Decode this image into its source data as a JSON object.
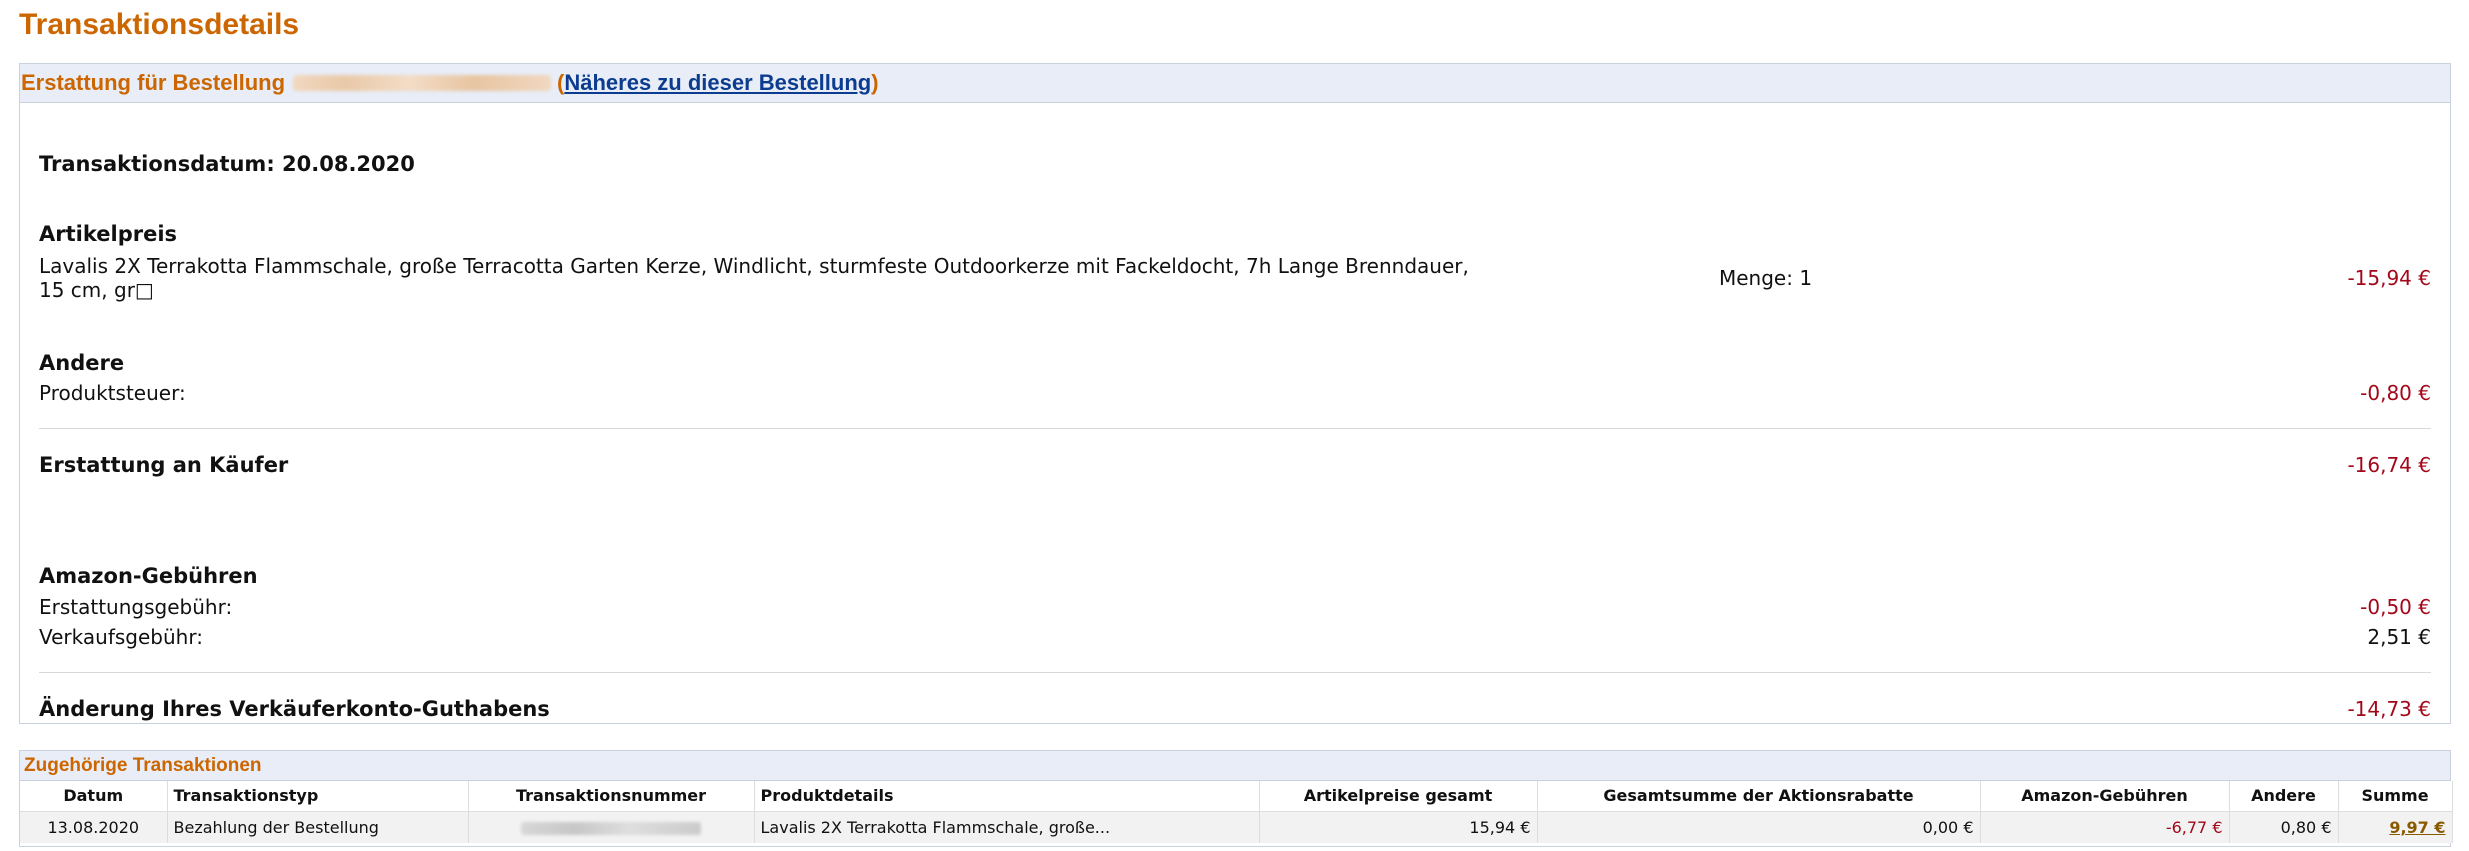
{
  "page": {
    "title": "Transaktionsdetails"
  },
  "refund": {
    "header_prefix": "Erstattung für Bestellung",
    "open_paren": "(",
    "order_link": "Näheres zu dieser Bestellung",
    "close_paren": ")",
    "transaction_date": "Transaktionsdatum: 20.08.2020",
    "article_price": {
      "title": "Artikelpreis",
      "description": "Lavalis 2X Terrakotta Flammschale, große Terracotta Garten Kerze, Windlicht, sturmfeste Outdoorkerze mit Fackeldocht, 7h Lange Brenndauer, 15 cm, gr□",
      "quantity": "Menge: 1",
      "amount": "-15,94 €"
    },
    "other": {
      "title": "Andere",
      "product_tax_label": "Produktsteuer:",
      "product_tax_amount": "-0,80 €"
    },
    "buyer_refund": {
      "label": "Erstattung an Käufer",
      "amount": "-16,74 €"
    },
    "amazon_fees": {
      "title": "Amazon-Gebühren",
      "refund_fee_label": "Erstattungsgebühr:",
      "refund_fee_amount": "-0,50 €",
      "sales_fee_label": "Verkaufsgebühr:",
      "sales_fee_amount": "2,51 €"
    },
    "balance_change": {
      "label": "Änderung Ihres Verkäuferkonto-Guthabens",
      "amount": "-14,73 €"
    }
  },
  "related": {
    "title": "Zugehörige Transaktionen",
    "columns": [
      "Datum",
      "Transaktionstyp",
      "Transaktionsnummer",
      "Produktdetails",
      "Artikelpreise gesamt",
      "Gesamtsumme der Aktionsrabatte",
      "Amazon-Gebühren",
      "Andere",
      "Summe"
    ],
    "row": {
      "date": "13.08.2020",
      "type": "Bezahlung der Bestellung",
      "product": "Lavalis 2X Terrakotta Flammschale, große...",
      "article_total": "15,94 €",
      "promo_total": "0,00 €",
      "amazon_fees": "-6,77 €",
      "other": "0,80 €",
      "sum": "9,97 €"
    }
  }
}
